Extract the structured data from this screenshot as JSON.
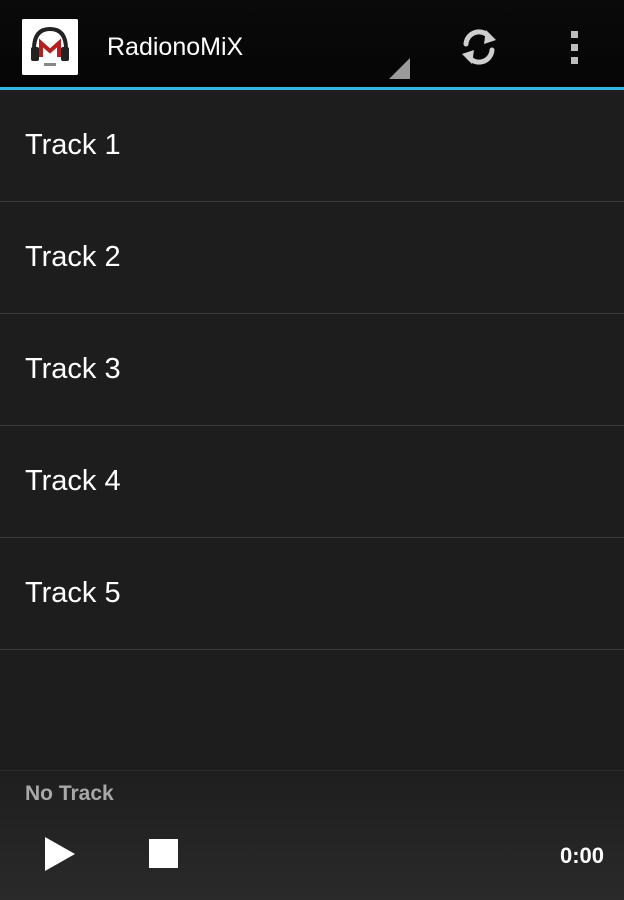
{
  "actionbar": {
    "title": "RadionoMiX",
    "app_icon": "radio-headphones-logo-icon",
    "refresh_icon": "refresh-icon",
    "overflow_icon": "overflow-menu-icon",
    "accent_color": "#33b5e5"
  },
  "tracks": [
    {
      "label": "Track 1"
    },
    {
      "label": "Track 2"
    },
    {
      "label": "Track 3"
    },
    {
      "label": "Track 4"
    },
    {
      "label": "Track 5"
    }
  ],
  "player": {
    "now_playing": "No Track",
    "time": "0:00",
    "play_icon": "play-icon",
    "stop_icon": "stop-icon"
  }
}
